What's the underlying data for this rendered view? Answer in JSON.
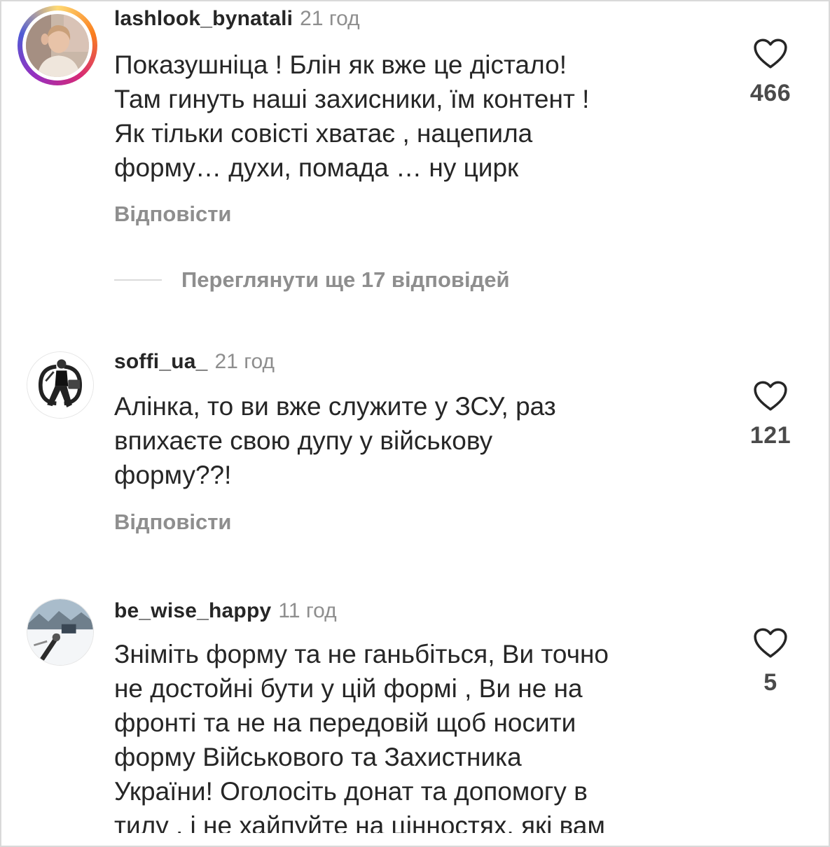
{
  "comments": [
    {
      "username": "lashlook_bynatali",
      "time": "21 год",
      "text": "Показушніца ! Блін як вже це дістало!\nТам гинуть наші захисники, їм контент !\nЯк тільки совісті хватає , нацепила\nформу… духи, помада … ну цирк",
      "likes": "466",
      "reply_label": "Відповісти"
    },
    {
      "username": "soffi_ua_",
      "time": "21 год",
      "text": "Алінка, то ви вже служите у ЗСУ, раз\nвпихаєте свою дупу у військову\nформу??!",
      "likes": "121",
      "reply_label": "Відповісти"
    },
    {
      "username": "be_wise_happy",
      "time": "11 год",
      "text": "Зніміть форму  та не ганьбіться, Ви точно\nне достойні бути у  цій формі , Ви не на\nфронті та не на передовій щоб носити\nформу Військового та Захистника\nУкраїни! Оголосіть донат та допомогу в\nтилу , і не хайпуйте на цінностях, які вам",
      "likes": "5"
    }
  ],
  "view_replies_label": "Переглянути ще 17 відповідей",
  "icons": {
    "like": "heart-outline-icon"
  },
  "colors": {
    "text": "#262626",
    "muted": "#8e8e8e",
    "divider": "#dbdbdb"
  }
}
